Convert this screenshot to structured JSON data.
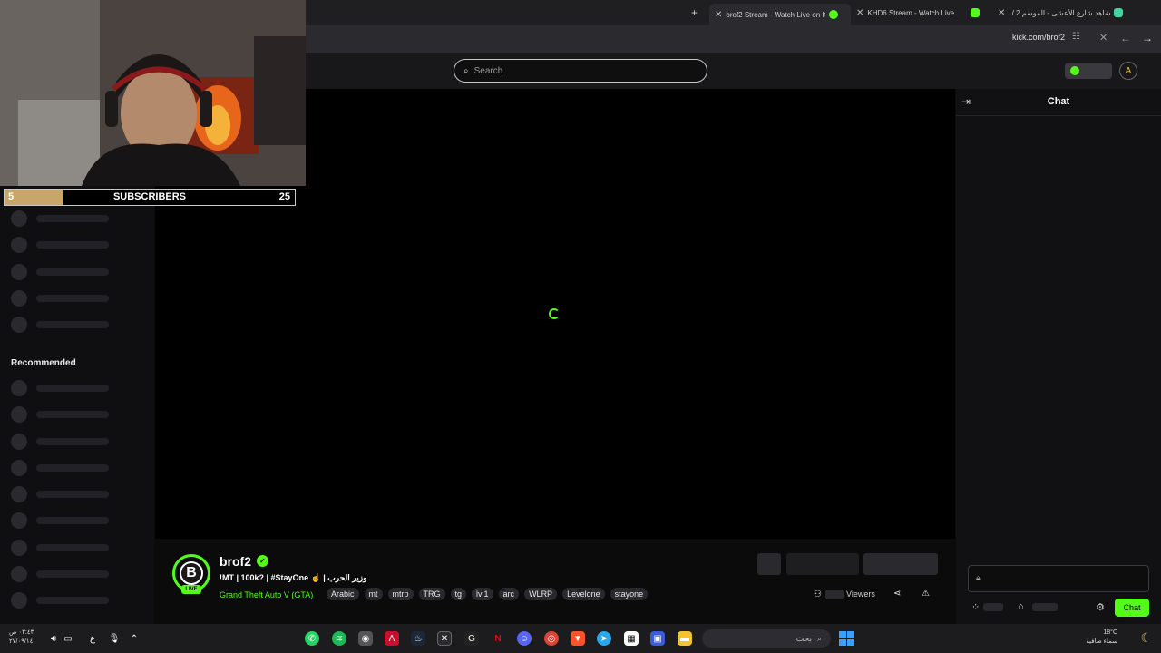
{
  "browser": {
    "tabs": [
      {
        "title": "brof2 Stream - Watch Live on K",
        "active": true
      },
      {
        "title": "KHD6 Stream - Watch Live",
        "active": false
      },
      {
        "title": "شاهد شارع الأعشى - الموسم 2 /",
        "active": false
      }
    ],
    "url": "kick.com/brof2",
    "new_tab_symbol": "+",
    "close_symbol": "✕"
  },
  "kick": {
    "search_placeholder": "Search",
    "header_avatar_letter": "A"
  },
  "overlay": {
    "subscribers_label": "SUBSCRIBERS",
    "current": "5",
    "goal": "25",
    "progress": 0.2
  },
  "sidebar": {
    "recommended_label": "Recommended"
  },
  "stream": {
    "avatar_letter": "B",
    "live_label": "LIVE",
    "channel_name": "brof2",
    "title": "!MT | 100k? | #StayOne ☝️ | وزير الحرب",
    "category": "Grand Theft Auto V (GTA)",
    "tags": [
      "Arabic",
      "mt",
      "mtrp",
      "TRG",
      "tg",
      "lvl1",
      "arc",
      "WLRP",
      "Levelone",
      "stayone"
    ],
    "viewers_label": "Viewers"
  },
  "chat": {
    "title": "Chat",
    "send_label": "Chat"
  },
  "taskbar": {
    "time_line1": "٠٣:٤٣ ص",
    "time_line2": "٢٧/٠٩/١٤",
    "lang": "ع",
    "search_placeholder": "بحث",
    "temperature": "18°C",
    "weather": "سماء صافية"
  },
  "colors": {
    "kick_green": "#53fc18",
    "sub_gold": "#c8a568"
  }
}
